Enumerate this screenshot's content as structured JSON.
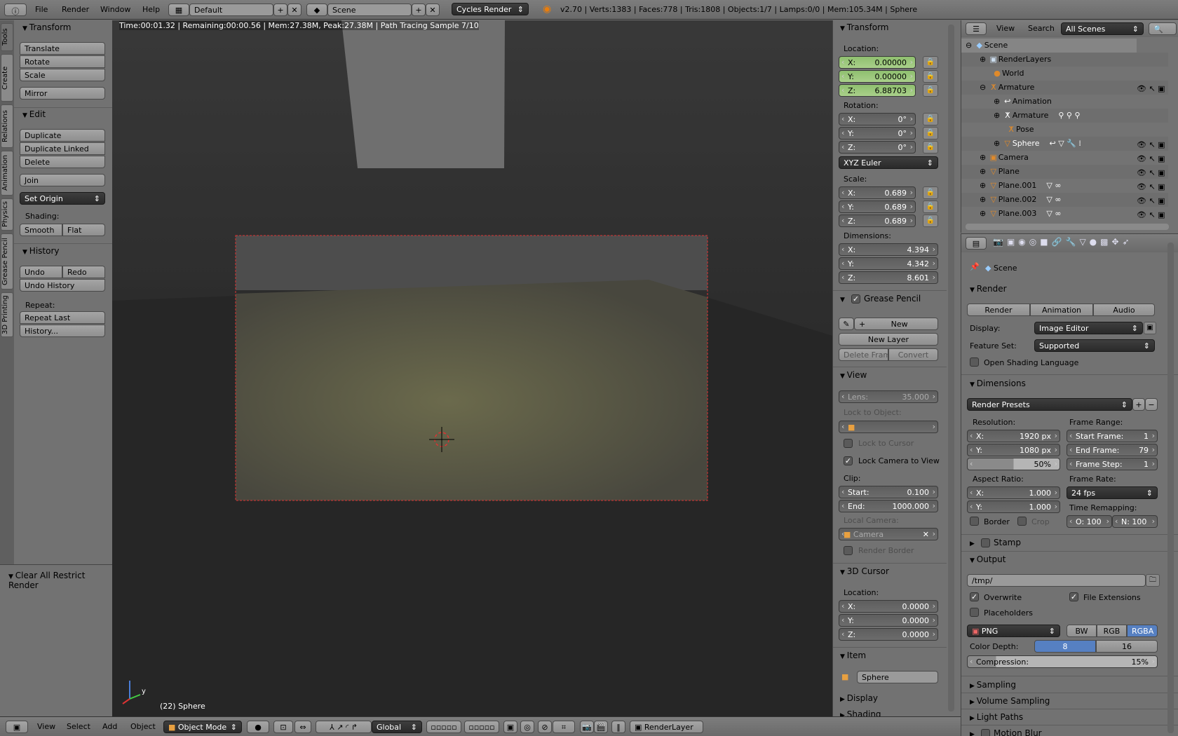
{
  "topbar": {
    "menus": [
      "File",
      "Render",
      "Window",
      "Help"
    ],
    "layout": "Default",
    "scene": "Scene",
    "engine": "Cycles Render",
    "stats": "v2.70 | Verts:1383 | Faces:778 | Tris:1808 | Objects:1/7 | Lamps:0/0 | Mem:105.34M | Sphere"
  },
  "tabs": [
    "Tools",
    "Create",
    "Relations",
    "Animation",
    "Physics",
    "Grease Pencil",
    "3D Printing"
  ],
  "tools": {
    "transform": "Transform",
    "translate": "Translate",
    "rotate": "Rotate",
    "scale": "Scale",
    "mirror": "Mirror",
    "edit": "Edit",
    "duplicate": "Duplicate",
    "duplicate_linked": "Duplicate Linked",
    "delete": "Delete",
    "join": "Join",
    "set_origin": "Set Origin",
    "shading_label": "Shading:",
    "smooth": "Smooth",
    "flat": "Flat",
    "history": "History",
    "undo": "Undo",
    "redo": "Redo",
    "undo_history": "Undo History",
    "repeat_label": "Repeat:",
    "repeat_last": "Repeat Last",
    "history_btn": "History...",
    "operator": "Clear All Restrict Render"
  },
  "viewport": {
    "render_info": "Time:00:01.32 | Remaining:00:00.56 | Mem:27.38M, Peak:27.38M | Path Tracing Sample 7/10",
    "object_label": "(22) Sphere",
    "axis_y": "y"
  },
  "npanel": {
    "transform": "Transform",
    "location": "Location:",
    "loc": [
      {
        "k": "X:",
        "v": "0.00000"
      },
      {
        "k": "Y:",
        "v": "0.00000"
      },
      {
        "k": "Z:",
        "v": "6.88703"
      }
    ],
    "rotation": "Rotation:",
    "rot": [
      {
        "k": "X:",
        "v": "0°"
      },
      {
        "k": "Y:",
        "v": "0°"
      },
      {
        "k": "Z:",
        "v": "0°"
      }
    ],
    "rot_mode": "XYZ Euler",
    "scale": "Scale:",
    "scl": [
      {
        "k": "X:",
        "v": "0.689"
      },
      {
        "k": "Y:",
        "v": "0.689"
      },
      {
        "k": "Z:",
        "v": "0.689"
      }
    ],
    "dimensions": "Dimensions:",
    "dim": [
      {
        "k": "X:",
        "v": "4.394"
      },
      {
        "k": "Y:",
        "v": "4.342"
      },
      {
        "k": "Z:",
        "v": "8.601"
      }
    ],
    "grease": "Grease Pencil",
    "new": "New",
    "new_layer": "New Layer",
    "delete_frame": "Delete Frame",
    "convert": "Convert",
    "view": "View",
    "lens": {
      "k": "Lens:",
      "v": "35.000"
    },
    "lock_object": "Lock to Object:",
    "lock_cursor": "Lock to Cursor",
    "lock_camera": "Lock Camera to View",
    "clip": "Clip:",
    "clip_start": {
      "k": "Start:",
      "v": "0.100"
    },
    "clip_end": {
      "k": "End:",
      "v": "1000.000"
    },
    "local_camera": "Local Camera:",
    "camera": "Camera",
    "render_border": "Render Border",
    "cursor": "3D Cursor",
    "cursor_location": "Location:",
    "cur": [
      {
        "k": "X:",
        "v": "0.0000"
      },
      {
        "k": "Y:",
        "v": "0.0000"
      },
      {
        "k": "Z:",
        "v": "0.0000"
      }
    ],
    "item": "Item",
    "item_name": "Sphere",
    "display": "Display",
    "shading": "Shading"
  },
  "outliner": {
    "view": "View",
    "search": "Search",
    "filter": "All Scenes",
    "rows": [
      "Scene",
      "RenderLayers",
      "World",
      "Armature",
      "Animation",
      "Armature",
      "Pose",
      "Sphere",
      "Camera",
      "Plane",
      "Plane.001",
      "Plane.002",
      "Plane.003"
    ]
  },
  "props": {
    "context": "Scene",
    "render": "Render",
    "render_btn": "Render",
    "animation_btn": "Animation",
    "audio_btn": "Audio",
    "display_label": "Display:",
    "display": "Image Editor",
    "feature_label": "Feature Set:",
    "feature": "Supported",
    "osl": "Open Shading Language",
    "dimensions": "Dimensions",
    "presets": "Render Presets",
    "resolution": "Resolution:",
    "res_x": {
      "k": "X:",
      "v": "1920 px"
    },
    "res_y": {
      "k": "Y:",
      "v": "1080 px"
    },
    "res_pct": "50%",
    "frame_range": "Frame Range:",
    "start": {
      "k": "Start Frame:",
      "v": "1"
    },
    "end": {
      "k": "End Frame:",
      "v": "79"
    },
    "step": {
      "k": "Frame Step:",
      "v": "1"
    },
    "aspect": "Aspect Ratio:",
    "asp_x": {
      "k": "X:",
      "v": "1.000"
    },
    "asp_y": {
      "k": "Y:",
      "v": "1.000"
    },
    "frame_rate": "Frame Rate:",
    "fps": "24 fps",
    "time_remap": "Time Remapping:",
    "old": "O: 100",
    "new": "N: 100",
    "border": "Border",
    "crop": "Crop",
    "stamp": "Stamp",
    "output": "Output",
    "path": "/tmp/",
    "overwrite": "Overwrite",
    "file_ext": "File Extensions",
    "placeholders": "Placeholders",
    "format": "PNG",
    "bw": "BW",
    "rgb": "RGB",
    "rgba": "RGBA",
    "depth_label": "Color Depth:",
    "d8": "8",
    "d16": "16",
    "compression": {
      "k": "Compression:",
      "v": "15%"
    },
    "compression_value": 15,
    "resolution_percentage": 50,
    "sampling": "Sampling",
    "volume": "Volume Sampling",
    "light_paths": "Light Paths",
    "motion_blur": "Motion Blur"
  },
  "bottombar": {
    "menus": [
      "View",
      "Select",
      "Add",
      "Object"
    ],
    "mode": "Object Mode",
    "orientation": "Global",
    "render_layer": "RenderLayer"
  },
  "colors": {
    "accent": "#5680c2",
    "location_field": "#9cc77d",
    "viewport": "#393939"
  }
}
